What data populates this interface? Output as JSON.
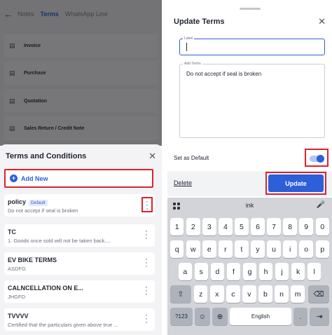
{
  "left": {
    "tabs": [
      "Notes",
      "Terms",
      "WhatsApp Line"
    ],
    "active_tab": "Terms",
    "background_items": [
      "Invoice",
      "Purchase",
      "Quotation",
      "Sales Return / Credit Note"
    ],
    "sheet_title": "Terms and Conditions",
    "add_new_label": "Add New",
    "terms": [
      {
        "name": "policy",
        "badge": "Default",
        "desc": "Do not accept if seal is broken"
      },
      {
        "name": "TC",
        "desc": "1. Goods once sold will not be taken back...."
      },
      {
        "name": "EV BIKE TERMS",
        "desc": "ASDFG"
      },
      {
        "name": "CALNCELLATION ON E...",
        "desc": "JHGFD"
      },
      {
        "name": "TVVVV",
        "desc": "Certified that the particulars given above true ..."
      }
    ]
  },
  "right": {
    "title": "Update Terms",
    "label_field_tag": "Label",
    "label_value": "",
    "terms_field_tag": "Add Terms",
    "terms_value": "Do not accept if seal is broken",
    "set_default_label": "Set as Default",
    "set_default_on": true,
    "delete_label": "Delete",
    "update_label": "Update"
  },
  "keyboard": {
    "suggestion": "ink",
    "row_numbers": [
      "1",
      "2",
      "3",
      "4",
      "5",
      "6",
      "7",
      "8",
      "9",
      "0"
    ],
    "row_1": [
      "q",
      "w",
      "e",
      "r",
      "t",
      "y",
      "u",
      "i",
      "o",
      "p"
    ],
    "row_2": [
      "a",
      "s",
      "d",
      "f",
      "g",
      "h",
      "j",
      "k",
      "l"
    ],
    "row_3": [
      "z",
      "x",
      "c",
      "v",
      "b",
      "n",
      "m"
    ],
    "symbols_key": "?123",
    "space_label": "English",
    "period_key": "."
  },
  "colors": {
    "accent": "#2d5fd8",
    "highlight": "#d9242e"
  }
}
